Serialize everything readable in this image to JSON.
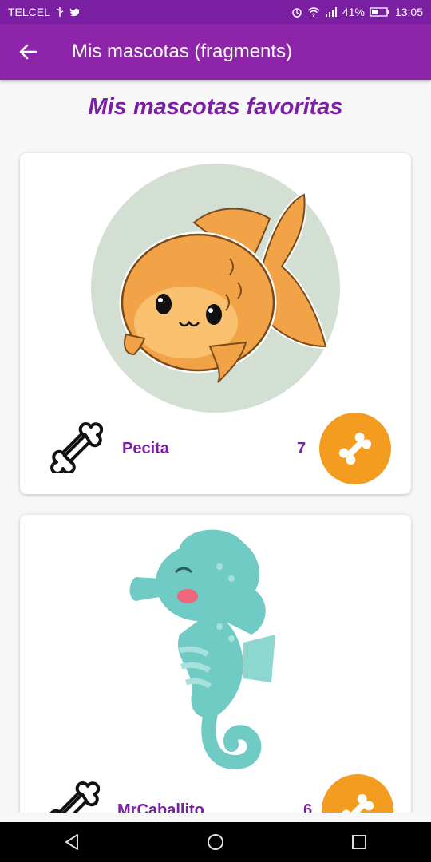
{
  "status_bar": {
    "carrier": "TELCEL",
    "battery": "41%",
    "time": "13:05",
    "icons": [
      "usb-icon",
      "twitter-icon",
      "alarm-icon",
      "wifi-icon",
      "signal-icon",
      "battery-icon"
    ]
  },
  "app_bar": {
    "title": "Mis mascotas (fragments)",
    "back_icon": "arrow-left-icon"
  },
  "main": {
    "heading": "Mis mascotas favoritas",
    "pets": [
      {
        "name": "Pecita",
        "likes": "7",
        "image": "goldfish-illustration"
      },
      {
        "name": "MrCaballito",
        "likes": "6",
        "image": "seahorse-illustration"
      }
    ]
  },
  "nav_bar": {
    "buttons": [
      "back-triangle-icon",
      "home-circle-icon",
      "recents-square-icon"
    ]
  },
  "colors": {
    "primary": "#8e24aa",
    "primary_dark": "#7b1fa2",
    "accent": "#f39c1f"
  }
}
